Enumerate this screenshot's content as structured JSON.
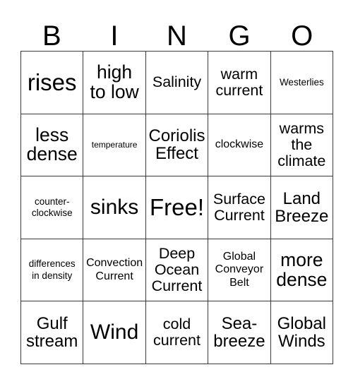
{
  "card": {
    "title": "BINGO",
    "header_letters": [
      "B",
      "I",
      "N",
      "G",
      "O"
    ],
    "free_space_label": "Free!",
    "colors": {
      "text": "#000000",
      "grid_line": "#3a3a3a",
      "background": "#ffffff"
    },
    "grid": {
      "columns": 5,
      "rows": 5,
      "cells": [
        [
          {
            "text": "rises",
            "size": "fs-5xl"
          },
          {
            "text": "high\nto low",
            "size": "fs-3xl"
          },
          {
            "text": "Salinity",
            "size": "fs-xl"
          },
          {
            "text": "warm\ncurrent",
            "size": "fs-xl"
          },
          {
            "text": "Westerlies",
            "size": "fs-sm"
          }
        ],
        [
          {
            "text": "less\ndense",
            "size": "fs-3xl"
          },
          {
            "text": "temperature",
            "size": "fs-xs"
          },
          {
            "text": "Coriolis\nEffect",
            "size": "fs-2xl"
          },
          {
            "text": "clockwise",
            "size": "fs-md"
          },
          {
            "text": "warms\nthe\nclimate",
            "size": "fs-xl"
          }
        ],
        [
          {
            "text": "counter-\nclockwise",
            "size": "fs-sm"
          },
          {
            "text": "sinks",
            "size": "fs-4xl"
          },
          {
            "text": "Free!",
            "size": "fs-5xl"
          },
          {
            "text": "Surface\nCurrent",
            "size": "fs-xl"
          },
          {
            "text": "Land\nBreeze",
            "size": "fs-2xl"
          }
        ],
        [
          {
            "text": "differences\nin density",
            "size": "fs-sm"
          },
          {
            "text": "Convection\nCurrent",
            "size": "fs-md"
          },
          {
            "text": "Deep\nOcean\nCurrent",
            "size": "fs-xl"
          },
          {
            "text": "Global\nConveyor\nBelt",
            "size": "fs-md"
          },
          {
            "text": "more\ndense",
            "size": "fs-3xl"
          }
        ],
        [
          {
            "text": "Gulf\nstream",
            "size": "fs-2xl"
          },
          {
            "text": "Wind",
            "size": "fs-4xl"
          },
          {
            "text": "cold\ncurrent",
            "size": "fs-xl"
          },
          {
            "text": "Sea-\nbreeze",
            "size": "fs-2xl"
          },
          {
            "text": "Global\nWinds",
            "size": "fs-2xl"
          }
        ]
      ]
    }
  }
}
